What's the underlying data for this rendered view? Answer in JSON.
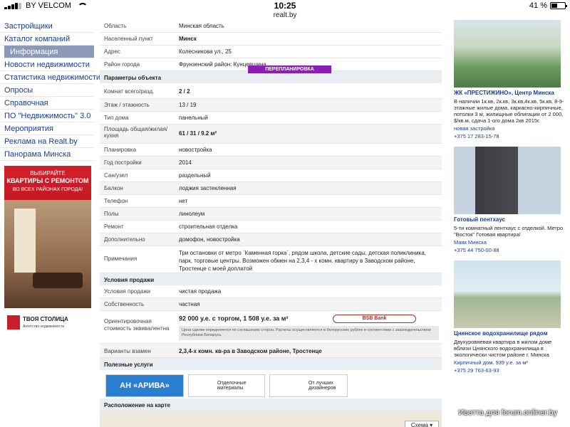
{
  "status": {
    "carrier": "BY VELCOM",
    "time": "10:25",
    "battery": "41 %",
    "battery_level": 0.41
  },
  "url": "realt.by",
  "nav": {
    "items": [
      "Застройщики",
      "Каталог компаний",
      "Информация",
      "Новости недвижимости",
      "Статистика недвижимости",
      "Опросы",
      "Справочная",
      "ПО \"Недвижимость\" 3.0",
      "Мероприятия",
      "Реклама на Realt.by",
      "Панорама Минска"
    ],
    "active_index": 2
  },
  "banner": {
    "line1": "ВЫБИРАЙТЕ",
    "line2": "КВАРТИРЫ С РЕМОНТОМ",
    "line3": "ВО ВСЕХ РАЙОНАХ ГОРОДА!",
    "brand": "ТВОЯ СТОЛИЦА",
    "brand_sub": "Агентство недвижимости"
  },
  "location": [
    {
      "label": "Область",
      "value": "Минская область"
    },
    {
      "label": "Населенный пункт",
      "value": "Минск"
    },
    {
      "label": "Адрес",
      "value": "Колесникова ул., 25"
    },
    {
      "label": "Район города",
      "value": "Фрунзенский район: Кунцевщина"
    }
  ],
  "params_title": "Параметры объекта",
  "replan_tag": "ПЕРЕПЛАНИРОВКА",
  "params": [
    {
      "label": "Комнат всего/разд.",
      "value": "2 / 2"
    },
    {
      "label": "Этаж / этажность",
      "value": "13 / 19"
    },
    {
      "label": "Тип дома",
      "value": "панельный"
    },
    {
      "label": "Площадь общая/жилая/кухня",
      "value": "61 / 31 / 9.2 м²"
    },
    {
      "label": "Планировка",
      "value": "новостройка"
    },
    {
      "label": "Год постройки",
      "value": "2014"
    },
    {
      "label": "Сан/узел",
      "value": "раздельный"
    },
    {
      "label": "Балкон",
      "value": "лоджия застекленная"
    },
    {
      "label": "Телефон",
      "value": "нет"
    },
    {
      "label": "Полы",
      "value": "линолеум"
    },
    {
      "label": "Ремонт",
      "value": "строительная отделка"
    },
    {
      "label": "Дополнительно",
      "value": "домофон, новостройка"
    },
    {
      "label": "Примечания",
      "value": "Три остановки от метро `Каменная горка`, рядом школа, детские сады, детская поликлиника, парк, торговые центры. Возможен обмен на 2,3,4 - х комн. квартиру в Заводском районе, Тростенце с моей доплатой"
    }
  ],
  "sale_title": "Условия продажи",
  "sale": [
    {
      "label": "Условия продажи",
      "value": "чистая продажа"
    },
    {
      "label": "Собственность",
      "value": "частная"
    }
  ],
  "price": {
    "label": "Ориентировочная стоимость эквивалентна",
    "value": "92 000 у.е. с торгом, 1 508 у.е. за м²",
    "bank": "BSB Bank",
    "note": "Цена сделки определяется по соглашению сторон. Расчеты осуществляются в белорусских рублях в соответствии с законодательством Республики Беларусь."
  },
  "exchange": {
    "label": "Варианты взамен",
    "value": "2,3,4-х комн. кв-ра в Заводском районе, Тростенце"
  },
  "services_title": "Полезные услуги",
  "services": {
    "ariva": "АН «АРИВА»",
    "materials": "Отделочные материалы",
    "designers": "От лучших дизайнеров"
  },
  "map_title": "Расположение на карте",
  "map_button": "Схема ▾",
  "listings": [
    {
      "title": "ЖК «ПРЕСТИЖИНО», Центр Минска",
      "desc": "В наличии 1к.кв, 2к.кв, 3к.кв,4к.кв, 5к.кв, 8-9-этажные жилые дома, каркасно-кирпичные, потолки 3 м, жилищные облигации от 2 000, $/кв.м, сдача 1-ого дома 2кв 2015г.",
      "meta": "новая застройка",
      "phone": "+375 17 283-15-78"
    },
    {
      "title": "Готовый пентхаус",
      "desc": "5-ти комнатный пентхаус с отделкой. Метро \"Восток\" Готовая квартира!",
      "meta": "Маяк Минска",
      "phone": "+375 44 750-00-88"
    },
    {
      "title": "Цнянское водохранилище рядом",
      "desc": "Двухуровневая квартира в жилом доме вблизи Цнянского водохранилища в экологически чистом районе г. Минска",
      "meta": "Кирпичный дом. 939 у.е. за м²",
      "phone": "+375 29 763-63-93"
    }
  ],
  "watermark": "Иветта для forum.onliner.by"
}
